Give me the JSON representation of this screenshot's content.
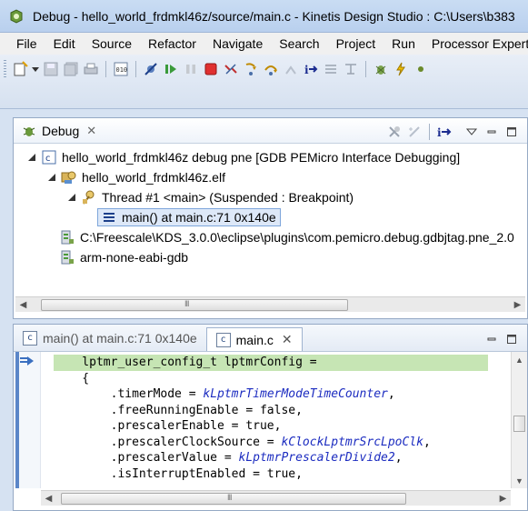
{
  "window": {
    "title": "Debug - hello_world_frdmkl46z/source/main.c - Kinetis Design Studio : C:\\Users\\b383"
  },
  "menu": [
    "File",
    "Edit",
    "Source",
    "Refactor",
    "Navigate",
    "Search",
    "Project",
    "Run",
    "Processor Expert"
  ],
  "debug_view": {
    "tab_label": "Debug",
    "tab_close": "✕",
    "tree": [
      {
        "label": "hello_world_frdmkl46z debug pne [GDB PEMicro Interface Debugging]",
        "icon": "c-launch-icon",
        "twisty": "◢"
      },
      {
        "label": "hello_world_frdmkl46z.elf",
        "icon": "process-icon",
        "twisty": "◢"
      },
      {
        "label": "Thread #1 <main> (Suspended : Breakpoint)",
        "icon": "thread-icon",
        "twisty": "◢"
      },
      {
        "label": "main() at main.c:71 0x140e",
        "icon": "stack-frame-icon"
      },
      {
        "label": "C:\\Freescale\\KDS_3.0.0\\eclipse\\plugins\\com.pemicro.debug.gdbjtag.pne_2.0",
        "icon": "gdb-server-icon"
      },
      {
        "label": "arm-none-eabi-gdb",
        "icon": "gdb-icon"
      }
    ],
    "hscroll_grip": "III"
  },
  "editor": {
    "tabs": [
      {
        "label": "main() at main.c:71 0x140e",
        "icon_letter": "c"
      },
      {
        "label": "main.c",
        "icon_letter": "c",
        "close": "✕"
      }
    ],
    "hscroll_grip": "III"
  },
  "colors": {
    "current_line": "#c6e5b4",
    "enum_constant": "#1c2cc0",
    "selection_border": "#7ea6db"
  }
}
